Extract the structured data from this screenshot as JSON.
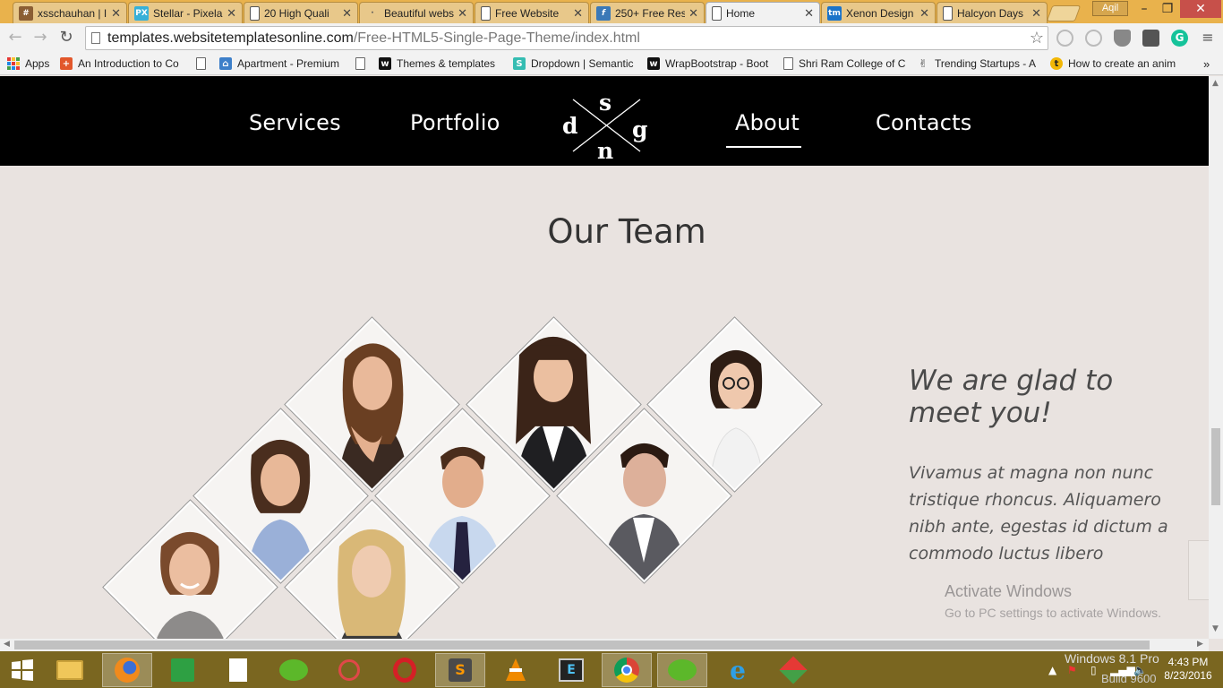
{
  "browser": {
    "tabs": [
      {
        "title": "xsschauhan | I",
        "icon": "hash-icon",
        "color": "#8b5e34",
        "glyph": "#"
      },
      {
        "title": "Stellar - Pixela",
        "icon": "pixelarity-icon",
        "color": "#37b0d8",
        "glyph": "PX"
      },
      {
        "title": "20 High Quali",
        "icon": "document-icon",
        "color": "",
        "glyph": ""
      },
      {
        "title": "Beautiful webs",
        "icon": "dot-icon",
        "color": "",
        "glyph": "·"
      },
      {
        "title": "Free Website",
        "icon": "document-icon",
        "color": "",
        "glyph": ""
      },
      {
        "title": "250+ Free Res",
        "icon": "f-icon",
        "color": "#3b79b7",
        "glyph": "f"
      },
      {
        "title": "Home",
        "icon": "document-icon",
        "color": "",
        "glyph": "",
        "active": true
      },
      {
        "title": "Xenon Design",
        "icon": "tm-icon",
        "color": "#1a73c9",
        "glyph": "tm"
      },
      {
        "title": "Halcyon Days",
        "icon": "document-icon",
        "color": "",
        "glyph": ""
      }
    ],
    "profile_name": "Aqil",
    "url_host": "templates.websitetemplatesonline.com",
    "url_path": "/Free-HTML5-Single-Page-Theme/index.html",
    "bookmarks": [
      {
        "label": "Apps",
        "icon": "apps-icon"
      },
      {
        "label": "An Introduction to Co",
        "icon": "plus-icon"
      },
      {
        "label": "",
        "icon": "document-icon"
      },
      {
        "label": "Apartment - Premium",
        "icon": "house-icon"
      },
      {
        "label": "",
        "icon": "document-icon"
      },
      {
        "label": "Themes & templates",
        "icon": "w-icon"
      },
      {
        "label": "Dropdown | Semantic",
        "icon": "s-icon"
      },
      {
        "label": "WrapBootstrap - Boot",
        "icon": "w-icon"
      },
      {
        "label": "Shri Ram College of C",
        "icon": "document-icon"
      },
      {
        "label": "Trending Startups - A",
        "icon": "peace-icon"
      },
      {
        "label": "How to create an anim",
        "icon": "tb-icon"
      }
    ]
  },
  "site": {
    "nav": {
      "services": "Services",
      "portfolio": "Portfolio",
      "about": "About",
      "contacts": "Contacts",
      "logo_letters": {
        "top": "s",
        "left": "d",
        "right": "g",
        "bottom": "n"
      }
    },
    "section_title": "Our Team",
    "intro_heading": "We are glad to meet you!",
    "intro_body": "Vivamus at magna non nunc tristique rhoncus. Aliquamero nibh ante, egestas id dictum a commodo luctus libero"
  },
  "os": {
    "activate_title": "Activate Windows",
    "activate_sub": "Go to PC settings to activate Windows.",
    "windows_version": "Windows 8.1 Pro",
    "build": "Build 9600",
    "time": "4:43 PM",
    "date": "8/23/2016"
  }
}
